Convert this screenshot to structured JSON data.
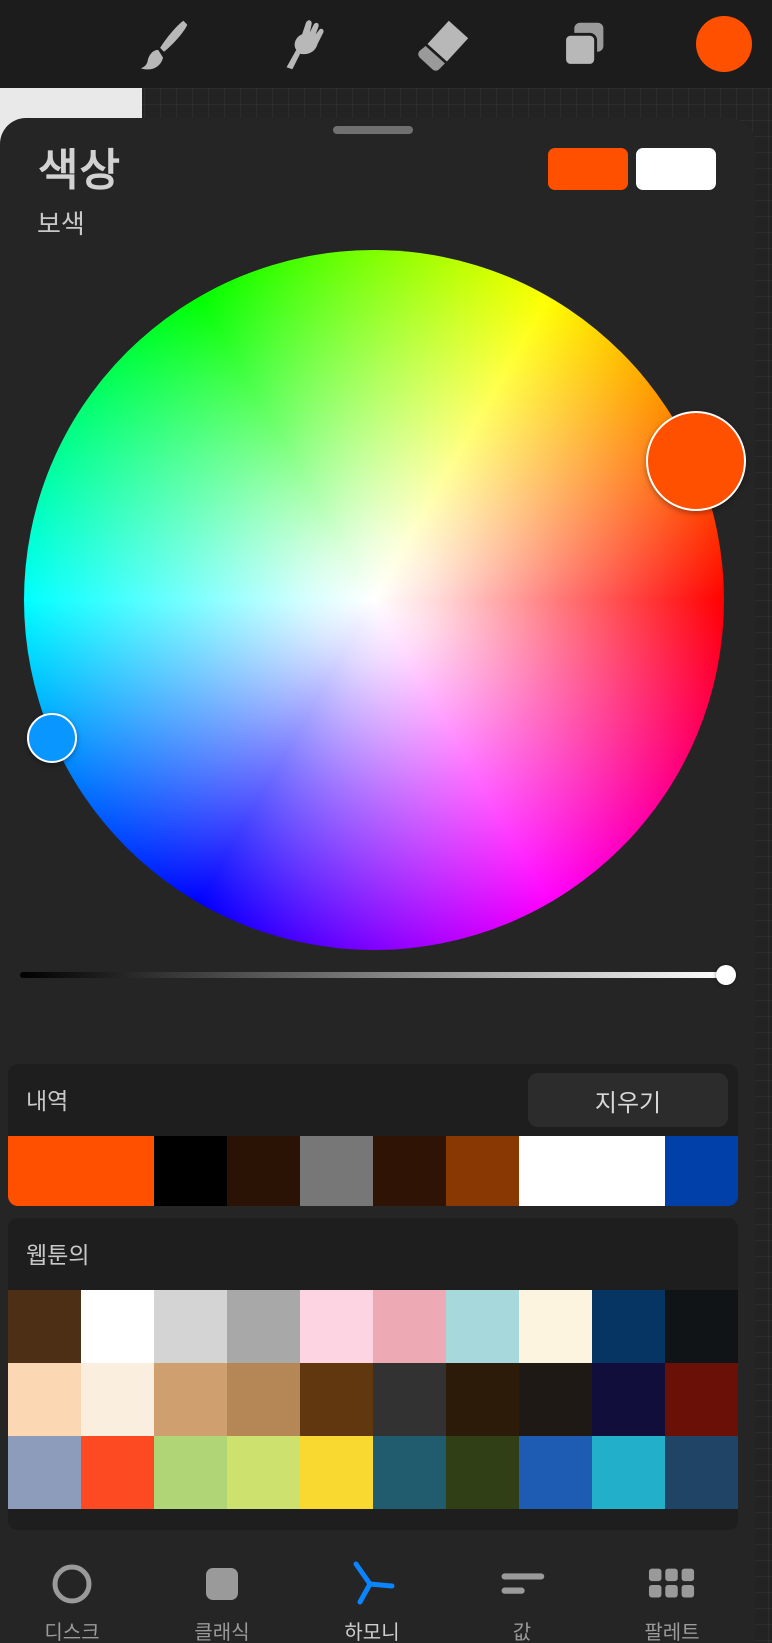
{
  "toolbar": {
    "tools": [
      "brush-icon",
      "smudge-icon",
      "eraser-icon",
      "layers-icon"
    ],
    "current_color": "#ff5000"
  },
  "panel": {
    "title": "색상",
    "subtitle": "보색",
    "primary_color": "#ff5000",
    "secondary_color": "#ffffff"
  },
  "wheel": {
    "selected_color": "#ff5000",
    "complement_color": "#0a96ff",
    "brightness": 1.0
  },
  "history": {
    "label": "내역",
    "clear_label": "지우기",
    "swatches": [
      {
        "color": "#ff5000",
        "span": 2
      },
      {
        "color": "#000000",
        "span": 1
      },
      {
        "color": "#2a1205",
        "span": 1
      },
      {
        "color": "#777777",
        "span": 1
      },
      {
        "color": "#2f1406",
        "span": 1
      },
      {
        "color": "#8a3803",
        "span": 1
      },
      {
        "color": "#ffffff",
        "span": 2
      },
      {
        "color": "#0040a8",
        "span": 1
      }
    ]
  },
  "palette": {
    "label": "웹툰의",
    "rows": [
      [
        "#4c2f15",
        "#ffffff",
        "#d4d4d4",
        "#a8a8a8",
        "#fdd4e2",
        "#eda9b4",
        "#a6d8dc",
        "#fdf4e0",
        "#063563",
        "#101416"
      ],
      [
        "#fcd7b4",
        "#faeede",
        "#cf9f70",
        "#b68756",
        "#61370f",
        "#323232",
        "#2d1b0a",
        "#1f1915",
        "#120e3c",
        "#6a1007"
      ],
      [
        "#8c9cba",
        "#fd4a22",
        "#afd577",
        "#cde26e",
        "#f9d830",
        "#205b6e",
        "#313f17",
        "#1e5cb3",
        "#21afca",
        "#1f4465"
      ]
    ]
  },
  "tabs": [
    {
      "label": "디스크",
      "icon": "disc-icon"
    },
    {
      "label": "클래식",
      "icon": "classic-icon"
    },
    {
      "label": "하모니",
      "icon": "harmony-icon"
    },
    {
      "label": "값",
      "icon": "value-icon"
    },
    {
      "label": "팔레트",
      "icon": "palette-icon"
    }
  ],
  "active_tab": 2,
  "colors": {
    "accent": "#0a84ff",
    "panel_bg": "#252525"
  }
}
